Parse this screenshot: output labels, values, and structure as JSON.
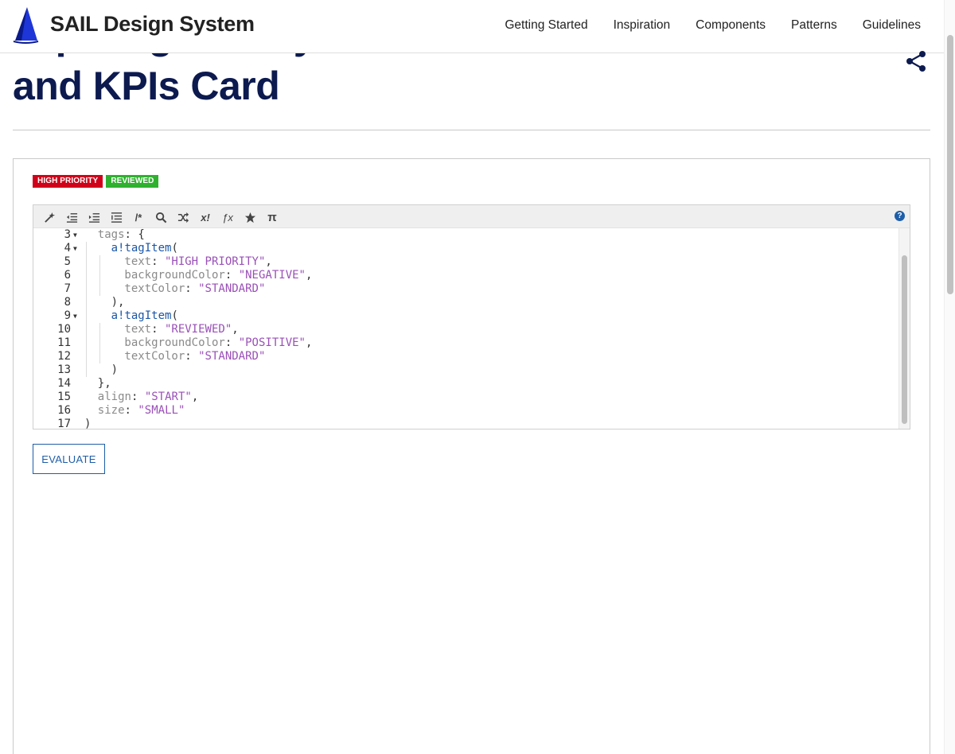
{
  "header": {
    "brand": "SAIL Design System",
    "nav": [
      "Getting Started",
      "Inspiration",
      "Components",
      "Patterns",
      "Guidelines"
    ]
  },
  "page": {
    "title_partial": "Tap Ling Gallery",
    "title_line": "and KPIs Card",
    "share_icon": "share-icon"
  },
  "example": {
    "tags": [
      {
        "text": "HIGH PRIORITY",
        "color": "#d0021b"
      },
      {
        "text": "REVIEWED",
        "color": "#2fb12f"
      }
    ],
    "toolbar_icons": [
      "magic-wand-icon",
      "outdent-icon",
      "indent-icon",
      "format-icon",
      "comment-icon",
      "search-icon",
      "shuffle-icon",
      "rule-icon",
      "function-icon",
      "star-icon",
      "pi-icon"
    ],
    "toolbar_glyphs": [
      "/*",
      "x!",
      "ƒx",
      "π"
    ],
    "help_glyph": "?",
    "code_lines": [
      {
        "n": "3",
        "fold": true,
        "indent": 1,
        "parts": [
          [
            "key",
            "tags"
          ],
          [
            "pun",
            ": {"
          ]
        ]
      },
      {
        "n": "4",
        "fold": true,
        "indent": 2,
        "parts": [
          [
            "kw",
            "a!tagItem"
          ],
          [
            "pun",
            "("
          ]
        ]
      },
      {
        "n": "5",
        "fold": false,
        "indent": 3,
        "parts": [
          [
            "key",
            "text"
          ],
          [
            "pun",
            ": "
          ],
          [
            "str",
            "\"HIGH PRIORITY\""
          ],
          [
            "pun",
            ","
          ]
        ]
      },
      {
        "n": "6",
        "fold": false,
        "indent": 3,
        "parts": [
          [
            "key",
            "backgroundColor"
          ],
          [
            "pun",
            ": "
          ],
          [
            "str",
            "\"NEGATIVE\""
          ],
          [
            "pun",
            ","
          ]
        ]
      },
      {
        "n": "7",
        "fold": false,
        "indent": 3,
        "parts": [
          [
            "key",
            "textColor"
          ],
          [
            "pun",
            ": "
          ],
          [
            "str",
            "\"STANDARD\""
          ]
        ]
      },
      {
        "n": "8",
        "fold": false,
        "indent": 2,
        "parts": [
          [
            "pun",
            "),"
          ]
        ]
      },
      {
        "n": "9",
        "fold": true,
        "indent": 2,
        "parts": [
          [
            "kw",
            "a!tagItem"
          ],
          [
            "pun",
            "("
          ]
        ]
      },
      {
        "n": "10",
        "fold": false,
        "indent": 3,
        "parts": [
          [
            "key",
            "text"
          ],
          [
            "pun",
            ": "
          ],
          [
            "str",
            "\"REVIEWED\""
          ],
          [
            "pun",
            ","
          ]
        ]
      },
      {
        "n": "11",
        "fold": false,
        "indent": 3,
        "parts": [
          [
            "key",
            "backgroundColor"
          ],
          [
            "pun",
            ": "
          ],
          [
            "str",
            "\"POSITIVE\""
          ],
          [
            "pun",
            ","
          ]
        ]
      },
      {
        "n": "12",
        "fold": false,
        "indent": 3,
        "parts": [
          [
            "key",
            "textColor"
          ],
          [
            "pun",
            ": "
          ],
          [
            "str",
            "\"STANDARD\""
          ]
        ]
      },
      {
        "n": "13",
        "fold": false,
        "indent": 2,
        "parts": [
          [
            "pun",
            ")"
          ]
        ]
      },
      {
        "n": "14",
        "fold": false,
        "indent": 1,
        "parts": [
          [
            "pun",
            "},"
          ]
        ]
      },
      {
        "n": "15",
        "fold": false,
        "indent": 1,
        "parts": [
          [
            "key",
            "align"
          ],
          [
            "pun",
            ": "
          ],
          [
            "str",
            "\"START\""
          ],
          [
            "pun",
            ","
          ]
        ]
      },
      {
        "n": "16",
        "fold": false,
        "indent": 1,
        "parts": [
          [
            "key",
            "size"
          ],
          [
            "pun",
            ": "
          ],
          [
            "str",
            "\"SMALL\""
          ]
        ]
      },
      {
        "n": "17",
        "fold": false,
        "indent": 0,
        "parts": [
          [
            "pun",
            ")"
          ]
        ]
      }
    ],
    "evaluate_label": "EVALUATE"
  },
  "colors": {
    "title": "#0c1a4f",
    "accent": "#1e5ea8",
    "keyword": "#1a56a8",
    "string": "#9a50b8"
  }
}
